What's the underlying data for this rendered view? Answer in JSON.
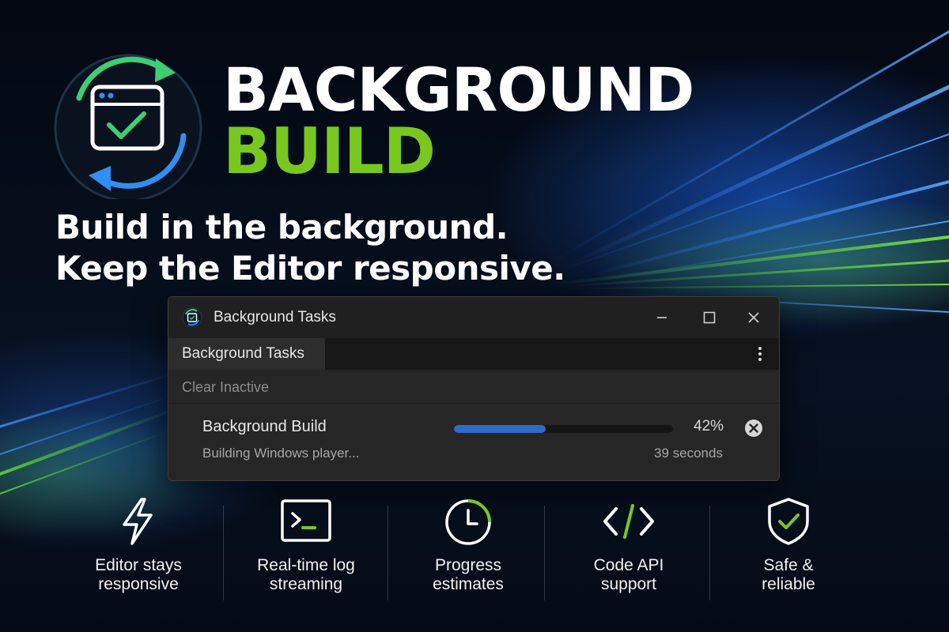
{
  "hero": {
    "title_line1": "BACKGROUND",
    "title_line2": "BUILD",
    "tagline_line1": "Build in the background.",
    "tagline_line2": "Keep the Editor responsive."
  },
  "window": {
    "title": "Background Tasks",
    "tab_label": "Background Tasks",
    "clear_label": "Clear Inactive",
    "task": {
      "name": "Background Build",
      "status": "Building Windows player...",
      "progress": 0.42,
      "percent_label": "42%",
      "time_label": "39 seconds"
    }
  },
  "features": [
    {
      "icon": "lightning-icon",
      "line1": "Editor stays",
      "line2": "responsive"
    },
    {
      "icon": "terminal-icon",
      "line1": "Real-time log",
      "line2": "streaming"
    },
    {
      "icon": "clock-icon",
      "line1": "Progress",
      "line2": "estimates"
    },
    {
      "icon": "code-icon",
      "line1": "Code API",
      "line2": "support"
    },
    {
      "icon": "shield-check-icon",
      "line1": "Safe &",
      "line2": "reliable"
    }
  ],
  "colors": {
    "accent_green": "#78c81e",
    "accent_blue": "#2f6bc8",
    "background": "#050b16"
  }
}
